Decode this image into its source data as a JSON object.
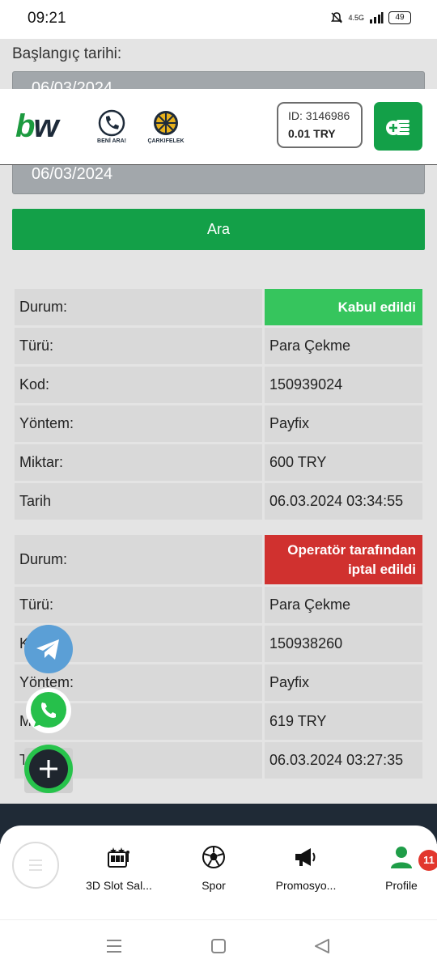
{
  "status_bar": {
    "time": "09:21",
    "network": "4.5G",
    "battery": "49"
  },
  "form": {
    "start_label": "Başlangıç tarihi:",
    "start_date": "06/03/2024",
    "end_date": "06/03/2024",
    "search_button": "Ara"
  },
  "header": {
    "logo_b": "b",
    "logo_w": "w",
    "call_label": "BENİ ARA!",
    "wheel_label": "ÇARKIFELEK",
    "account_id": "ID: 3146986",
    "balance": "0.01 TRY"
  },
  "transactions": [
    {
      "status_label": "Durum:",
      "status": "Kabul edildi",
      "status_color": "#36c55d",
      "rows": [
        {
          "label": "Türü:",
          "value": "Para Çekme"
        },
        {
          "label": "Kod:",
          "value": "150939024"
        },
        {
          "label": "Yöntem:",
          "value": "Payfix"
        },
        {
          "label": "Miktar:",
          "value": "600 TRY"
        },
        {
          "label": "Tarih",
          "value": "06.03.2024 03:34:55"
        }
      ]
    },
    {
      "status_label": "Durum:",
      "status": "Operatör tarafından iptal edildi",
      "status_color": "#d0312f",
      "rows": [
        {
          "label": "Türü:",
          "value": "Para Çekme"
        },
        {
          "label": "Kod:",
          "value": "150938260"
        },
        {
          "label": "Yöntem:",
          "value": "Payfix"
        },
        {
          "label": "Miktar:",
          "value": "619 TRY"
        },
        {
          "label": "Tarih",
          "value": "06.03.2024 03:27:35"
        }
      ]
    }
  ],
  "bottom_nav": {
    "items": [
      {
        "label": "3D Slot Sal...",
        "icon": "slot-machine-icon"
      },
      {
        "label": "Spor",
        "icon": "soccer-ball-icon"
      },
      {
        "label": "Promosyo...",
        "icon": "megaphone-icon"
      },
      {
        "label": "Profile",
        "icon": "user-icon"
      }
    ],
    "profile_badge": "11"
  }
}
